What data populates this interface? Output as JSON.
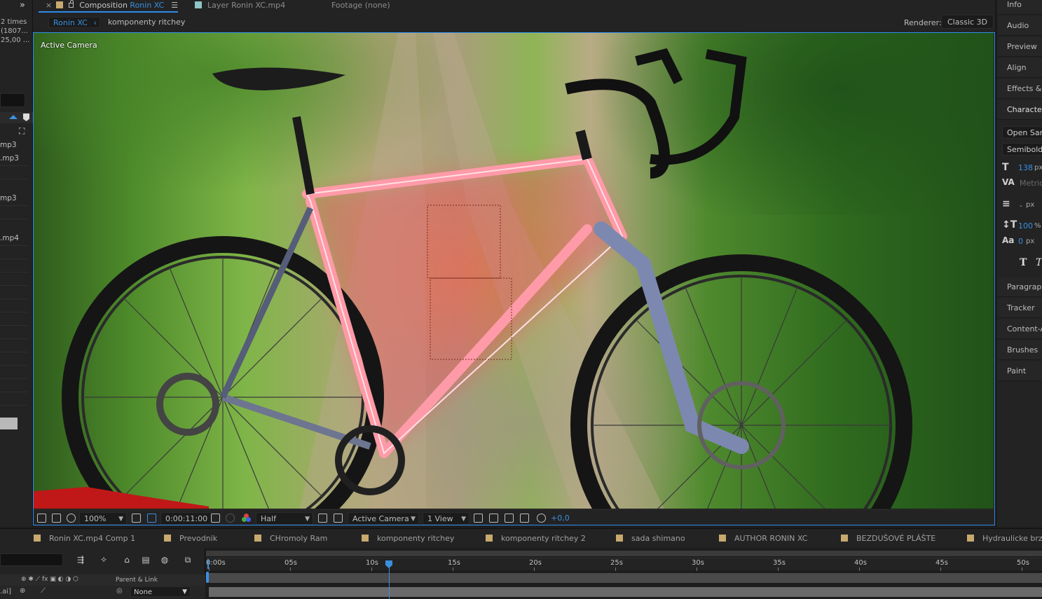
{
  "left_panel": {
    "meta_lines": [
      "2 times",
      "(1807...",
      "25,00 ..."
    ],
    "rows": [
      "mp3",
      ".mp3",
      "mp3",
      ".mp4"
    ]
  },
  "viewer": {
    "tabs": {
      "composition_prefix": "Composition",
      "composition_name": "Ronin XC",
      "layer": "Layer  Ronin XC.mp4",
      "footage": "Footage  (none)"
    },
    "breadcrumbs": [
      "Ronin XC",
      "komponenty ritchey"
    ],
    "renderer_label": "Renderer:",
    "renderer_value": "Classic 3D",
    "canvas_label": "Active Camera",
    "bottom": {
      "zoom": "100%",
      "timecode": "0:00:11:00",
      "resolution": "Half",
      "camera": "Active Camera",
      "views": "1 View",
      "exposure": "+0,0"
    }
  },
  "right_panel": {
    "items": [
      "Info",
      "Audio",
      "Preview",
      "Align",
      "Effects & Presets",
      "Character"
    ],
    "font_family": "Open Sans",
    "font_style": "Semibold",
    "font_size_value": "138",
    "font_size_unit": "px",
    "kerning": "Metrics",
    "leading_value": "-",
    "leading_unit": "px",
    "vscale_value": "100",
    "vscale_unit": "%",
    "baseline_value": "0",
    "baseline_unit": "px",
    "lower_items": [
      "Paragraph",
      "Tracker",
      "Content-Aware Fill",
      "Brushes",
      "Paint"
    ]
  },
  "timeline": {
    "tabs": [
      "Ronin XC.mp4 Comp 1",
      "Prevodnik",
      "CHromoly Ram",
      "komponenty ritchey",
      "komponenty ritchey 2",
      "sada shimano",
      "AUTHOR RONIN XC",
      "BEZDUŠOVÉ PLÁŠTE",
      "Hydraulicke brzdy"
    ],
    "parent_link_label": "Parent & Link",
    "layer_fragment": ".ai]",
    "parent_value": "None",
    "ruler_labels": [
      "0:00s",
      "05s",
      "10s",
      "15s",
      "20s",
      "25s",
      "30s",
      "35s",
      "40s",
      "45s",
      "50s"
    ]
  },
  "colors": {
    "accent": "#2d8ceb",
    "label_tan": "#c8a96e",
    "comp_swatch": "#c8a96e",
    "layer_swatch": "#8ec5c5"
  }
}
